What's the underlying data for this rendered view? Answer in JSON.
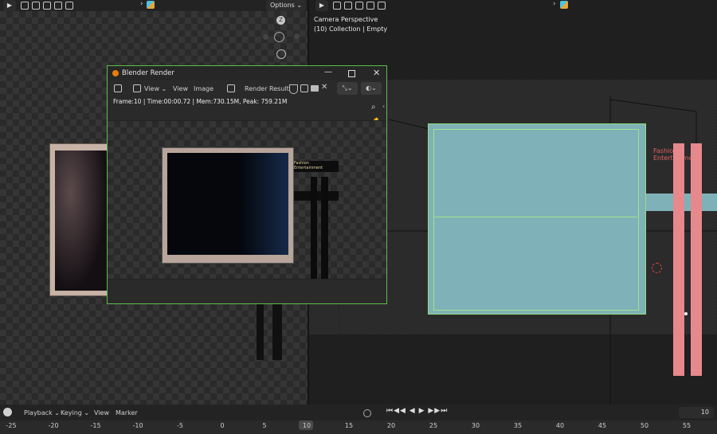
{
  "left_header": {
    "options_label": "Options ⌄"
  },
  "viewport": {
    "camera_label": "Camera Perspective",
    "collection_label": "(10) Collection | Empty",
    "gizmo_axis": "Z"
  },
  "render_window": {
    "title": "Blender Render",
    "menu": {
      "view1": "View",
      "view2": "View",
      "image": "Image",
      "render_result": "Render Result"
    },
    "stats": "Frame:10 | Time:00:00.72 | Mem:730.15M, Peak: 759.21M",
    "image_sign_text": "Fashion Entertainment"
  },
  "viewport_sign_text": "Fashion Entertainment",
  "timeline": {
    "menus": {
      "playback": "Playback",
      "keying": "Keying",
      "view": "View",
      "marker": "Marker"
    },
    "current_frame": "10",
    "ruler": [
      "-25",
      "-20",
      "-15",
      "-10",
      "-5",
      "0",
      "5",
      "10",
      "15",
      "20",
      "25",
      "30",
      "35",
      "40",
      "45",
      "50",
      "55"
    ],
    "current_marker": "10"
  },
  "colors": {
    "accent_green": "#5bbf4a",
    "selection_box": "#7fb1b8",
    "pink_pole": "#e6888c",
    "timeline_marker": "#4a4a4a"
  }
}
